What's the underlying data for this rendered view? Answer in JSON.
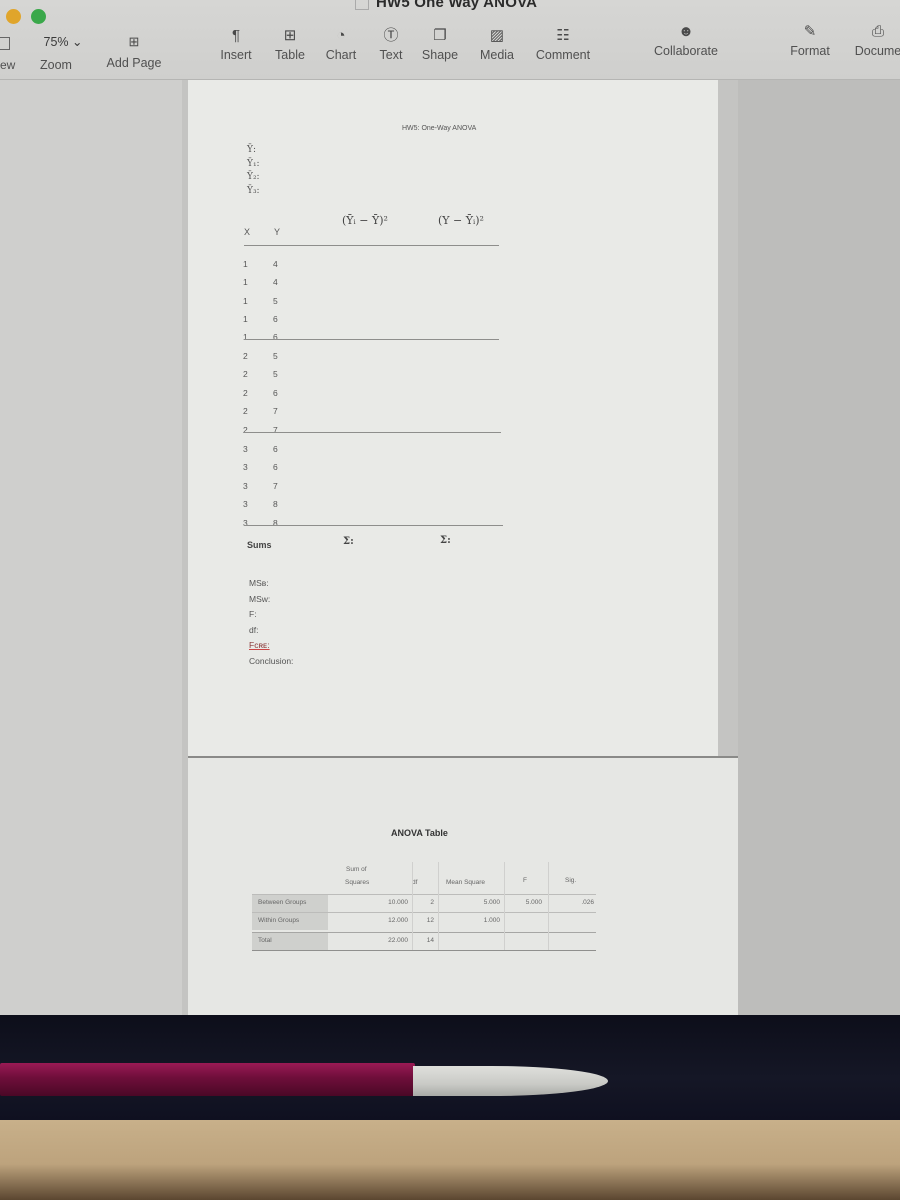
{
  "window": {
    "title": "HW5 One Way ANOVA"
  },
  "toolbar": {
    "view_label": "ew",
    "zoom_value": "75% ⌄",
    "zoom_label": "Zoom",
    "add_page_label": "Add Page",
    "items": [
      {
        "label": "Insert",
        "icon": "paragraph-icon",
        "glyph": "¶"
      },
      {
        "label": "Table",
        "icon": "table-icon",
        "glyph": "⊞"
      },
      {
        "label": "Chart",
        "icon": "chart-icon",
        "glyph": "◔"
      },
      {
        "label": "Text",
        "icon": "text-box-icon",
        "glyph": "Ⓣ"
      },
      {
        "label": "Shape",
        "icon": "shape-icon",
        "glyph": "❐"
      },
      {
        "label": "Media",
        "icon": "media-icon",
        "glyph": "▨"
      },
      {
        "label": "Comment",
        "icon": "comment-icon",
        "glyph": "☷"
      },
      {
        "label": "Collaborate",
        "icon": "collaborate-icon",
        "glyph": "☻"
      },
      {
        "label": "Format",
        "icon": "format-brush-icon",
        "glyph": "✎"
      },
      {
        "label": "Docume",
        "icon": "document-icon",
        "glyph": "⎙"
      }
    ]
  },
  "document": {
    "header": "HW5: One-Way ANOVA",
    "means": [
      "Ȳ:",
      "Ȳ₁:",
      "Ȳ₂:",
      "Ȳ₃:"
    ],
    "columns": {
      "x": "X",
      "y": "Y",
      "between": "(Ȳᵢ − Ȳ)²",
      "within": "(Y − Ȳᵢ)²"
    },
    "rows": [
      {
        "x": "1",
        "y": "4"
      },
      {
        "x": "1",
        "y": "4"
      },
      {
        "x": "1",
        "y": "5"
      },
      {
        "x": "1",
        "y": "6"
      },
      {
        "x": "1",
        "y": "6"
      },
      {
        "x": "2",
        "y": "5"
      },
      {
        "x": "2",
        "y": "5"
      },
      {
        "x": "2",
        "y": "6"
      },
      {
        "x": "2",
        "y": "7"
      },
      {
        "x": "2",
        "y": "7"
      },
      {
        "x": "3",
        "y": "6"
      },
      {
        "x": "3",
        "y": "6"
      },
      {
        "x": "3",
        "y": "7"
      },
      {
        "x": "3",
        "y": "8"
      },
      {
        "x": "3",
        "y": "8"
      }
    ],
    "sums_label": "Sums",
    "sigma_between": "Σ:",
    "sigma_within": "Σ:",
    "stats": {
      "msb": "MSʙ:",
      "msw": "MSᴡ:",
      "f": "F:",
      "df": "df:",
      "fcrit": "Fᴄʀᴇ:",
      "conclusion": "Conclusion:"
    }
  },
  "anova": {
    "title": "ANOVA Table",
    "headers": {
      "ss_line1": "Sum of",
      "ss_line2": "Squares",
      "df": "df",
      "ms": "Mean Square",
      "f": "F",
      "sig": "Sig."
    },
    "rows": [
      {
        "label": "Between Groups",
        "ss": "10.000",
        "df": "2",
        "ms": "5.000",
        "f": "5.000",
        "sig": ".026"
      },
      {
        "label": "Within Groups",
        "ss": "12.000",
        "df": "12",
        "ms": "1.000",
        "f": "",
        "sig": ""
      },
      {
        "label": "Total",
        "ss": "22.000",
        "df": "14",
        "ms": "",
        "f": "",
        "sig": ""
      }
    ]
  }
}
